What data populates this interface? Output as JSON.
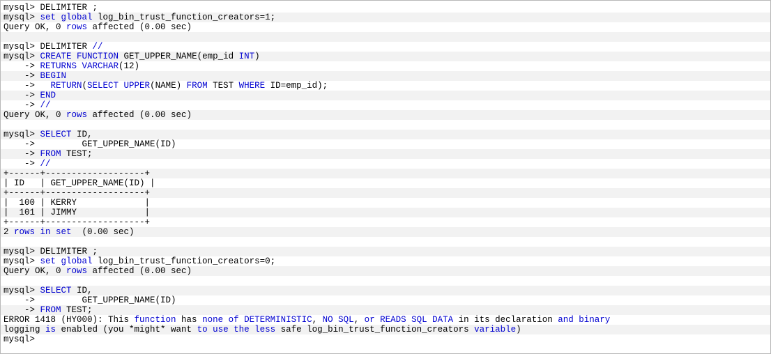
{
  "terminal": {
    "app": "mysql-client-console",
    "colors": {
      "background": "#ffffff",
      "stripe": "#f2f2f2",
      "border": "#b8b8b8",
      "text": "#000000",
      "keyword": "#0000d0"
    },
    "prompt": "mysql>",
    "continuation_prompt": "->",
    "lines": [
      {
        "id": "l1",
        "segments": [
          {
            "t": "mysql> DELIMITER ;",
            "k": false
          }
        ]
      },
      {
        "id": "l2",
        "segments": [
          {
            "t": "mysql> ",
            "k": false
          },
          {
            "t": "set global",
            "k": true
          },
          {
            "t": " log_bin_trust_function_creators=1;",
            "k": false
          }
        ]
      },
      {
        "id": "l3",
        "segments": [
          {
            "t": "Query OK, 0 ",
            "k": false
          },
          {
            "t": "rows",
            "k": true
          },
          {
            "t": " affected (0.00 sec)",
            "k": false
          }
        ]
      },
      {
        "id": "l4",
        "segments": [
          {
            "t": "",
            "k": false
          }
        ]
      },
      {
        "id": "l5",
        "segments": [
          {
            "t": "mysql> DELIMITER ",
            "k": false
          },
          {
            "t": "//",
            "k": true
          }
        ]
      },
      {
        "id": "l6",
        "segments": [
          {
            "t": "mysql> ",
            "k": false
          },
          {
            "t": "CREATE FUNCTION",
            "k": true
          },
          {
            "t": " GET_UPPER_NAME(emp_id ",
            "k": false
          },
          {
            "t": "INT",
            "k": true
          },
          {
            "t": ")",
            "k": false
          }
        ]
      },
      {
        "id": "l7",
        "segments": [
          {
            "t": "    -> ",
            "k": false
          },
          {
            "t": "RETURNS VARCHAR",
            "k": true
          },
          {
            "t": "(12)",
            "k": false
          }
        ]
      },
      {
        "id": "l8",
        "segments": [
          {
            "t": "    -> ",
            "k": false
          },
          {
            "t": "BEGIN",
            "k": true
          }
        ]
      },
      {
        "id": "l9",
        "segments": [
          {
            "t": "    ->   ",
            "k": false
          },
          {
            "t": "RETURN",
            "k": true
          },
          {
            "t": "(",
            "k": false
          },
          {
            "t": "SELECT UPPER",
            "k": true
          },
          {
            "t": "(NAME) ",
            "k": false
          },
          {
            "t": "FROM",
            "k": true
          },
          {
            "t": " TEST ",
            "k": false
          },
          {
            "t": "WHERE",
            "k": true
          },
          {
            "t": " ID=emp_id);",
            "k": false
          }
        ]
      },
      {
        "id": "l10",
        "segments": [
          {
            "t": "    -> ",
            "k": false
          },
          {
            "t": "END",
            "k": true
          }
        ]
      },
      {
        "id": "l11",
        "segments": [
          {
            "t": "    -> ",
            "k": false
          },
          {
            "t": "//",
            "k": true
          }
        ]
      },
      {
        "id": "l12",
        "segments": [
          {
            "t": "Query OK, 0 ",
            "k": false
          },
          {
            "t": "rows",
            "k": true
          },
          {
            "t": " affected (0.00 sec)",
            "k": false
          }
        ]
      },
      {
        "id": "l13",
        "segments": [
          {
            "t": "",
            "k": false
          }
        ]
      },
      {
        "id": "l14",
        "segments": [
          {
            "t": "mysql> ",
            "k": false
          },
          {
            "t": "SELECT",
            "k": true
          },
          {
            "t": " ID,",
            "k": false
          }
        ]
      },
      {
        "id": "l15",
        "segments": [
          {
            "t": "    ->         GET_UPPER_NAME(ID)",
            "k": false
          }
        ]
      },
      {
        "id": "l16",
        "segments": [
          {
            "t": "    -> ",
            "k": false
          },
          {
            "t": "FROM",
            "k": true
          },
          {
            "t": " TEST;",
            "k": false
          }
        ]
      },
      {
        "id": "l17",
        "segments": [
          {
            "t": "    -> ",
            "k": false
          },
          {
            "t": "//",
            "k": true
          }
        ]
      },
      {
        "id": "l18",
        "segments": [
          {
            "t": "+------+-------------------+",
            "k": false
          }
        ]
      },
      {
        "id": "l19",
        "segments": [
          {
            "t": "| ID   | GET_UPPER_NAME(ID) |",
            "k": false
          }
        ]
      },
      {
        "id": "l20",
        "segments": [
          {
            "t": "+------+-------------------+",
            "k": false
          }
        ]
      },
      {
        "id": "l21",
        "segments": [
          {
            "t": "|  100 | KERRY             |",
            "k": false
          }
        ]
      },
      {
        "id": "l22",
        "segments": [
          {
            "t": "|  101 | JIMMY             |",
            "k": false
          }
        ]
      },
      {
        "id": "l23",
        "segments": [
          {
            "t": "+------+-------------------+",
            "k": false
          }
        ]
      },
      {
        "id": "l24",
        "segments": [
          {
            "t": "2 ",
            "k": false
          },
          {
            "t": "rows in set",
            "k": true
          },
          {
            "t": "  (0.00 sec)",
            "k": false
          }
        ]
      },
      {
        "id": "l25",
        "segments": [
          {
            "t": "",
            "k": false
          }
        ]
      },
      {
        "id": "l26",
        "segments": [
          {
            "t": "mysql> DELIMITER ;",
            "k": false
          }
        ]
      },
      {
        "id": "l27",
        "segments": [
          {
            "t": "mysql> ",
            "k": false
          },
          {
            "t": "set global",
            "k": true
          },
          {
            "t": " log_bin_trust_function_creators=0;",
            "k": false
          }
        ]
      },
      {
        "id": "l28",
        "segments": [
          {
            "t": "Query OK, 0 ",
            "k": false
          },
          {
            "t": "rows",
            "k": true
          },
          {
            "t": " affected (0.00 sec)",
            "k": false
          }
        ]
      },
      {
        "id": "l29",
        "segments": [
          {
            "t": "",
            "k": false
          }
        ]
      },
      {
        "id": "l30",
        "segments": [
          {
            "t": "mysql> ",
            "k": false
          },
          {
            "t": "SELECT",
            "k": true
          },
          {
            "t": " ID,",
            "k": false
          }
        ]
      },
      {
        "id": "l31",
        "segments": [
          {
            "t": "    ->         GET_UPPER_NAME(ID)",
            "k": false
          }
        ]
      },
      {
        "id": "l32",
        "segments": [
          {
            "t": "    -> ",
            "k": false
          },
          {
            "t": "FROM",
            "k": true
          },
          {
            "t": " TEST;",
            "k": false
          }
        ]
      },
      {
        "id": "l33",
        "segments": [
          {
            "t": "ERROR 1418 (HY000): This ",
            "k": false
          },
          {
            "t": "function",
            "k": true
          },
          {
            "t": " has ",
            "k": false
          },
          {
            "t": "none of DETERMINISTIC",
            "k": true
          },
          {
            "t": ", ",
            "k": false
          },
          {
            "t": "NO SQL",
            "k": true
          },
          {
            "t": ", ",
            "k": false
          },
          {
            "t": "or READS SQL DATA",
            "k": true
          },
          {
            "t": " in its declaration ",
            "k": false
          },
          {
            "t": "and binary",
            "k": true
          }
        ]
      },
      {
        "id": "l34",
        "segments": [
          {
            "t": "logging ",
            "k": false
          },
          {
            "t": "is",
            "k": true
          },
          {
            "t": " enabled (you *might* want ",
            "k": false
          },
          {
            "t": "to use the less",
            "k": true
          },
          {
            "t": " safe log_bin_trust_function_creators ",
            "k": false
          },
          {
            "t": "variable",
            "k": true
          },
          {
            "t": ")",
            "k": false
          }
        ]
      },
      {
        "id": "l35",
        "segments": [
          {
            "t": "mysql>",
            "k": false
          }
        ]
      }
    ]
  }
}
